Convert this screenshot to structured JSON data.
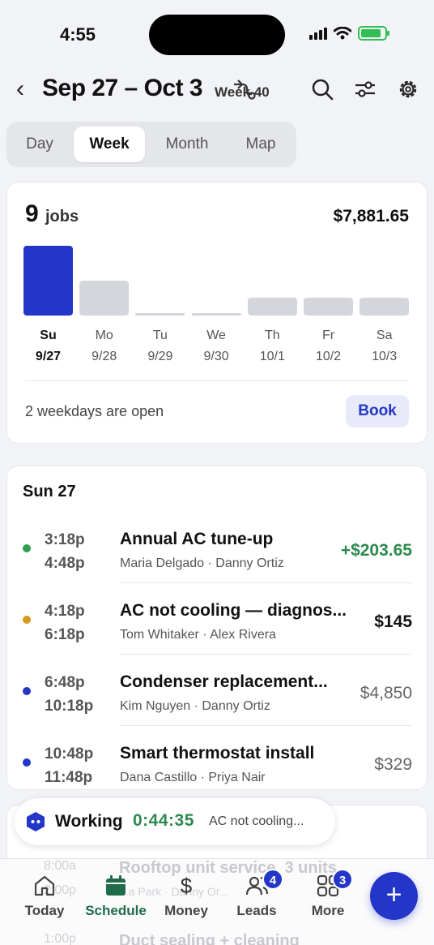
{
  "status_bar": {
    "time": "4:55"
  },
  "header": {
    "title": "Sep 27 – Oct 3",
    "week_label": "Week 40"
  },
  "view_tabs": [
    {
      "label": "Day",
      "active": false
    },
    {
      "label": "Week",
      "active": true
    },
    {
      "label": "Month",
      "active": false
    },
    {
      "label": "Map",
      "active": false
    }
  ],
  "summary": {
    "jobs_count": "9",
    "jobs_word": "jobs",
    "total": "$7,881.65",
    "open_text": "2 weekdays are open",
    "book_label": "Book"
  },
  "chart_data": {
    "type": "bar",
    "categories": [
      "Su",
      "Mo",
      "Tu",
      "We",
      "Th",
      "Fr",
      "Sa"
    ],
    "dates": [
      "9/27",
      "9/28",
      "9/29",
      "9/30",
      "10/1",
      "10/2",
      "10/3"
    ],
    "values": [
      4,
      2,
      0,
      0,
      1,
      1,
      1
    ],
    "active_index": 0,
    "colors": {
      "active": "#2336c8",
      "inactive": "#d4d6dc"
    }
  },
  "day_section": {
    "title": "Sun 27"
  },
  "jobs": [
    {
      "start": "3:18p",
      "end": "4:48p",
      "name": "Annual AC tune-up",
      "people": "Maria Delgado · Danny Ortiz",
      "price": "+$203.65",
      "status_color": "#2e9e4f",
      "price_style": "green"
    },
    {
      "start": "4:18p",
      "end": "6:18p",
      "name": "AC not cooling — diagnos...",
      "people": "Tom Whitaker · Alex Rivera",
      "price": "$145",
      "status_color": "#d69a1e",
      "price_style": "bold"
    },
    {
      "start": "6:48p",
      "end": "10:18p",
      "name": "Condenser replacement...",
      "people": "Kim Nguyen · Danny Ortiz",
      "price": "$4,850",
      "status_color": "#2336c8",
      "price_style": "muted"
    },
    {
      "start": "10:48p",
      "end": "11:48p",
      "name": "Smart thermostat install",
      "people": "Dana Castillo · Priya Nair",
      "price": "$329",
      "status_color": "#2336c8",
      "price_style": "muted"
    }
  ],
  "behind": {
    "time1": "8:00a",
    "name1": "Rooftop unit service, 3 units",
    "time2": "2:00p",
    "people2": "...a Park · Danny Or...",
    "time3": "1:00p",
    "name3": "Duct sealing + cleaning"
  },
  "working": {
    "label": "Working",
    "timer": "0:44:35",
    "job": "AC not cooling..."
  },
  "tabbar": {
    "items": [
      {
        "label": "Today",
        "icon": "home-icon",
        "active": false
      },
      {
        "label": "Schedule",
        "icon": "calendar-icon",
        "active": true
      },
      {
        "label": "Money",
        "icon": "dollar-icon",
        "active": false
      },
      {
        "label": "Leads",
        "icon": "people-icon",
        "active": false,
        "badge": "4"
      },
      {
        "label": "More",
        "icon": "grid-icon",
        "active": false,
        "badge": "3"
      }
    ],
    "fab": "+"
  },
  "colors": {
    "accent": "#2336c8",
    "success": "#2d8a4e",
    "schedule_active": "#1f6b4a"
  }
}
